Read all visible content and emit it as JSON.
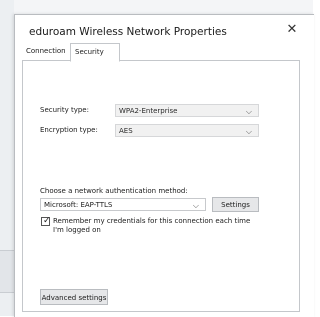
{
  "window": {
    "title": "eduroam Wireless Network Properties",
    "close_glyph": "✕"
  },
  "tabs": [
    {
      "label": "Connection"
    },
    {
      "label": "Security"
    }
  ],
  "security": {
    "security_type_label": "Security type:",
    "security_type_value": "WPA2-Enterprise",
    "encryption_type_label": "Encryption type:",
    "encryption_type_value": "AES",
    "auth_method_label": "Choose a network authentication method:",
    "auth_method_value": "Microsoft: EAP-TTLS",
    "settings_button": "Settings",
    "remember_checked": true,
    "remember_text": "Remember my credentials for this connection each time I'm logged on",
    "advanced_button": "Advanced settings"
  },
  "icons": {
    "dropdown": "chevron-down-icon",
    "close": "close-icon",
    "check": "checkmark-icon"
  }
}
